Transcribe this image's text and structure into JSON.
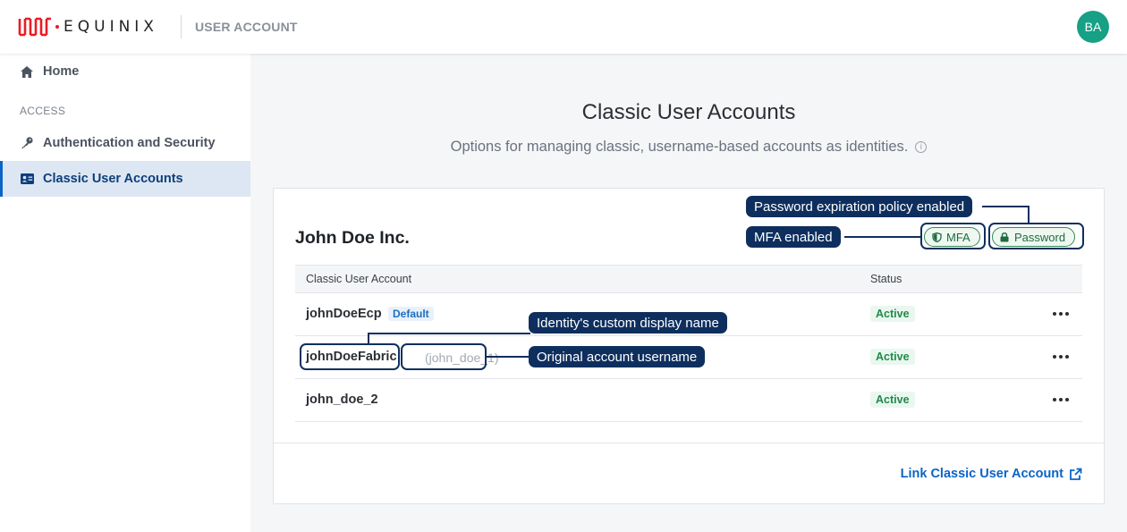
{
  "header": {
    "logo_text": "EQUINIX",
    "app_name": "USER ACCOUNT",
    "avatar_initials": "BA"
  },
  "sidebar": {
    "items": [
      {
        "label": "Home",
        "icon": "home-icon"
      },
      {
        "label": "Authentication and Security",
        "icon": "key-icon"
      },
      {
        "label": "Classic User Accounts",
        "icon": "id-card-icon",
        "active": true
      }
    ],
    "section_label": "ACCESS"
  },
  "main": {
    "title": "Classic User Accounts",
    "subtitle": "Options for managing classic, username-based accounts as identities.",
    "info_icon": "info-icon"
  },
  "card": {
    "org_name": "John Doe Inc.",
    "badges": {
      "mfa": "MFA",
      "password": "Password"
    },
    "table": {
      "columns": [
        "Classic User Account",
        "Status"
      ],
      "rows": [
        {
          "account": "johnDoeEcp",
          "tag": "Default",
          "original": "",
          "status": "Active"
        },
        {
          "account": "johnDoeFabric",
          "tag": "",
          "original": "(john_doe_1)",
          "status": "Active"
        },
        {
          "account": "john_doe_2",
          "tag": "",
          "original": "",
          "status": "Active"
        }
      ]
    },
    "link_label": "Link Classic User Account"
  },
  "callouts": {
    "password_policy": "Password expiration policy enabled",
    "mfa": "MFA enabled",
    "display_name": "Identity's custom display name",
    "original_username": "Original account username"
  },
  "colors": {
    "brand_red": "#e91c24",
    "accent_blue": "#0a64c6",
    "callout_navy": "#0e2f5e",
    "active_green": "#1f8a4a",
    "avatar_teal": "#16a085"
  }
}
